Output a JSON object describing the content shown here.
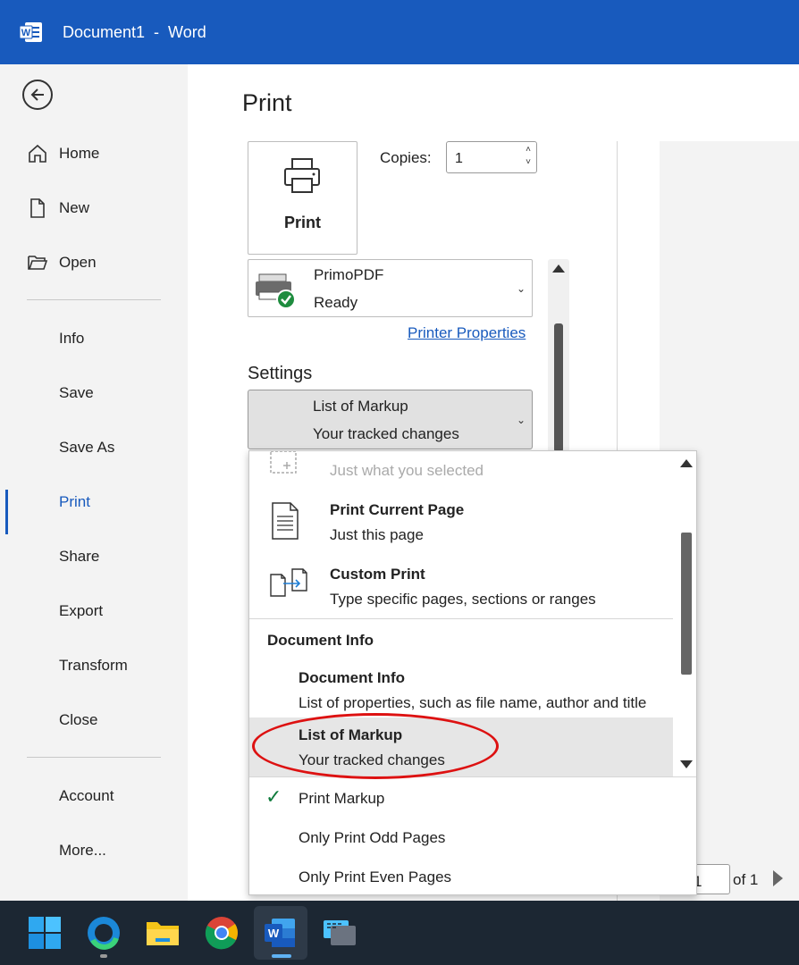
{
  "window": {
    "title": "Document1  -  Word"
  },
  "nav": {
    "items": [
      {
        "label": "Home"
      },
      {
        "label": "New"
      },
      {
        "label": "Open"
      },
      {
        "label": "Info"
      },
      {
        "label": "Save"
      },
      {
        "label": "Save As"
      },
      {
        "label": "Print"
      },
      {
        "label": "Share"
      },
      {
        "label": "Export"
      },
      {
        "label": "Transform"
      },
      {
        "label": "Close"
      },
      {
        "label": "Account"
      },
      {
        "label": "More..."
      }
    ],
    "active": "Print"
  },
  "print": {
    "heading": "Print",
    "button_label": "Print",
    "copies_label": "Copies:",
    "copies_value": "1",
    "printer_name": "PrimoPDF",
    "printer_status": "Ready",
    "printer_properties": "Printer Properties",
    "settings_label": "Settings",
    "selected_title": "List of Markup",
    "selected_desc": "Your tracked changes",
    "page_number": "1",
    "page_of": "of 1"
  },
  "dropdown": {
    "selection_desc": "Just what you selected",
    "current_page_title": "Print Current Page",
    "current_page_desc": "Just this page",
    "custom_title": "Custom Print",
    "custom_desc": "Type specific pages, sections or ranges",
    "section_header": "Document Info",
    "doc_info_title": "Document Info",
    "doc_info_desc": "List of properties, such as file name, author and title",
    "markup_title": "List of Markup",
    "markup_desc": "Your tracked changes",
    "print_markup": "Print Markup",
    "print_markup_checked": true,
    "odd_pages": "Only Print Odd Pages",
    "even_pages": "Only Print Even Pages"
  },
  "colors": {
    "titlebar": "#185abd",
    "accent": "#185abd",
    "annotation": "#dd1111",
    "check": "#0f7b3c"
  },
  "taskbar": {
    "icons": [
      "windows-start-icon",
      "edge-icon",
      "file-explorer-icon",
      "chrome-icon",
      "word-icon",
      "keyboard-app-icon"
    ]
  }
}
